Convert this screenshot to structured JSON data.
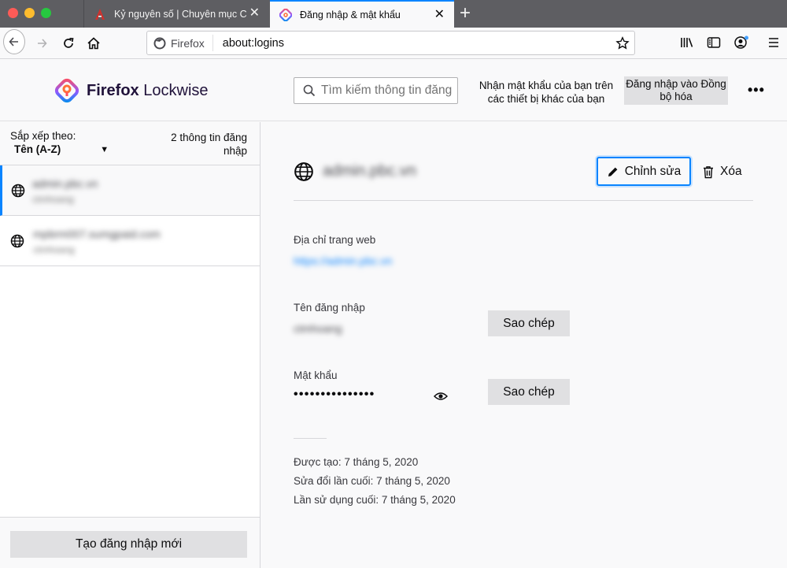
{
  "tabs": [
    {
      "title": "Kỷ nguyên số | Chuyên mục CNTT",
      "active": false
    },
    {
      "title": "Đăng nhập & mật khẩu",
      "active": true
    }
  ],
  "urlbar": {
    "identity": "Firefox",
    "url": "about:logins"
  },
  "header": {
    "brand_name": "Firefox",
    "brand_product": "Lockwise",
    "search_placeholder": "Tìm kiếm thông tin đăng nhập",
    "sync_text": "Nhận mật khẩu của bạn trên các thiết bị khác của bạn",
    "sync_button": "Đăng nhập vào Đồng bộ hóa",
    "more_label": "•••"
  },
  "sidebar": {
    "sort_label": "Sắp xếp theo:",
    "sort_value": "Tên (A-Z)",
    "count_text": "2 thông tin đăng nhập",
    "items": [
      {
        "title": "admin.pbc.vn",
        "subtitle": "ctmhoang",
        "selected": true
      },
      {
        "title": "mpbrm007.sumgpaid.com",
        "subtitle": "ctmhoang",
        "selected": false
      }
    ],
    "create_button": "Tạo đăng nhập mới"
  },
  "detail": {
    "title": "admin.pbc.vn",
    "edit_button": "Chỉnh sửa",
    "delete_button": "Xóa",
    "website_label": "Địa chỉ trang web",
    "website_value": "https://admin.pbc.vn",
    "username_label": "Tên đăng nhập",
    "username_value": "ctmhoang",
    "password_label": "Mật khẩu",
    "password_dots": "•••••••••••••••",
    "copy_button": "Sao chép",
    "created": "Được tạo: 7 tháng 5, 2020",
    "modified": "Sửa đổi lần cuối: 7 tháng 5, 2020",
    "last_used": "Lần sử dụng cuối: 7 tháng 5, 2020"
  },
  "colors": {
    "accent": "#0a84ff",
    "tabstrip": "#5e5e62",
    "button": "#e0e0e2"
  }
}
